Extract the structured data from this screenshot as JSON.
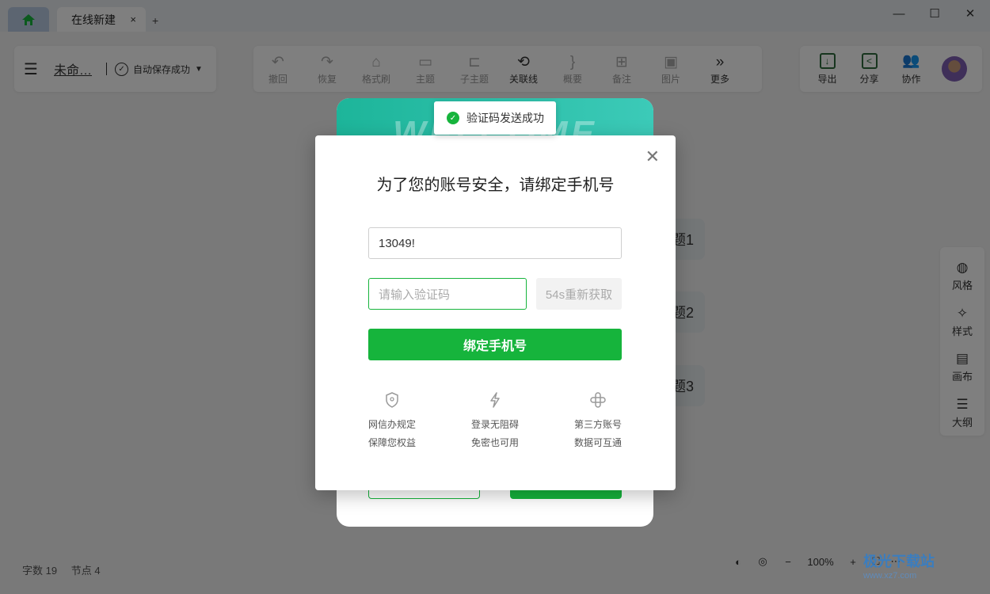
{
  "tabs": {
    "home_icon": "home-icon",
    "doc_label": "在线新建",
    "close": "×",
    "add": "+"
  },
  "window": {
    "minimize": "—",
    "maximize": "☐",
    "close": "✕"
  },
  "menu": {
    "file_name": "未命…",
    "save_status": "自动保存成功"
  },
  "toolbar": [
    {
      "label": "撤回",
      "icon": "↶"
    },
    {
      "label": "恢复",
      "icon": "↷"
    },
    {
      "label": "格式刷",
      "icon": "⌂"
    },
    {
      "label": "主题",
      "icon": "▭"
    },
    {
      "label": "子主题",
      "icon": "⊏"
    },
    {
      "label": "关联线",
      "icon": "⟲"
    },
    {
      "label": "概要",
      "icon": "}"
    },
    {
      "label": "备注",
      "icon": "⊞"
    },
    {
      "label": "图片",
      "icon": "▣"
    },
    {
      "label": "更多",
      "icon": "»"
    }
  ],
  "right_tools": [
    {
      "label": "导出",
      "icon": "↓"
    },
    {
      "label": "分享",
      "icon": "<"
    },
    {
      "label": "协作",
      "icon": "👥"
    }
  ],
  "side_tools": [
    {
      "label": "风格",
      "icon": "◍"
    },
    {
      "label": "样式",
      "icon": "✧"
    },
    {
      "label": "画布",
      "icon": "▤"
    },
    {
      "label": "大纲",
      "icon": "☰"
    }
  ],
  "nodes": [
    "题1",
    "题2",
    "题3"
  ],
  "status": {
    "word_count": "字数  19",
    "node_count": "节点  4"
  },
  "bottom": {
    "zoom": "100%",
    "minus": "−",
    "plus": "+"
  },
  "back_dialog": {
    "banner_text": "WELCOME"
  },
  "dialog": {
    "title": "为了您的账号安全，请绑定手机号",
    "phone_value": "13049!",
    "code_placeholder": "请输入验证码",
    "resend_label": "54s重新获取",
    "bind_label": "绑定手机号",
    "features": [
      {
        "line1": "网信办规定",
        "line2": "保障您权益",
        "icon": "shield-icon"
      },
      {
        "line1": "登录无阻碍",
        "line2": "免密也可用",
        "icon": "lightning-icon"
      },
      {
        "line1": "第三方账号",
        "line2": "数据可互通",
        "icon": "link-icon"
      }
    ]
  },
  "toast": {
    "message": "验证码发送成功"
  },
  "watermark": {
    "text": "极光下载站",
    "sub": "www.xz7.com"
  }
}
